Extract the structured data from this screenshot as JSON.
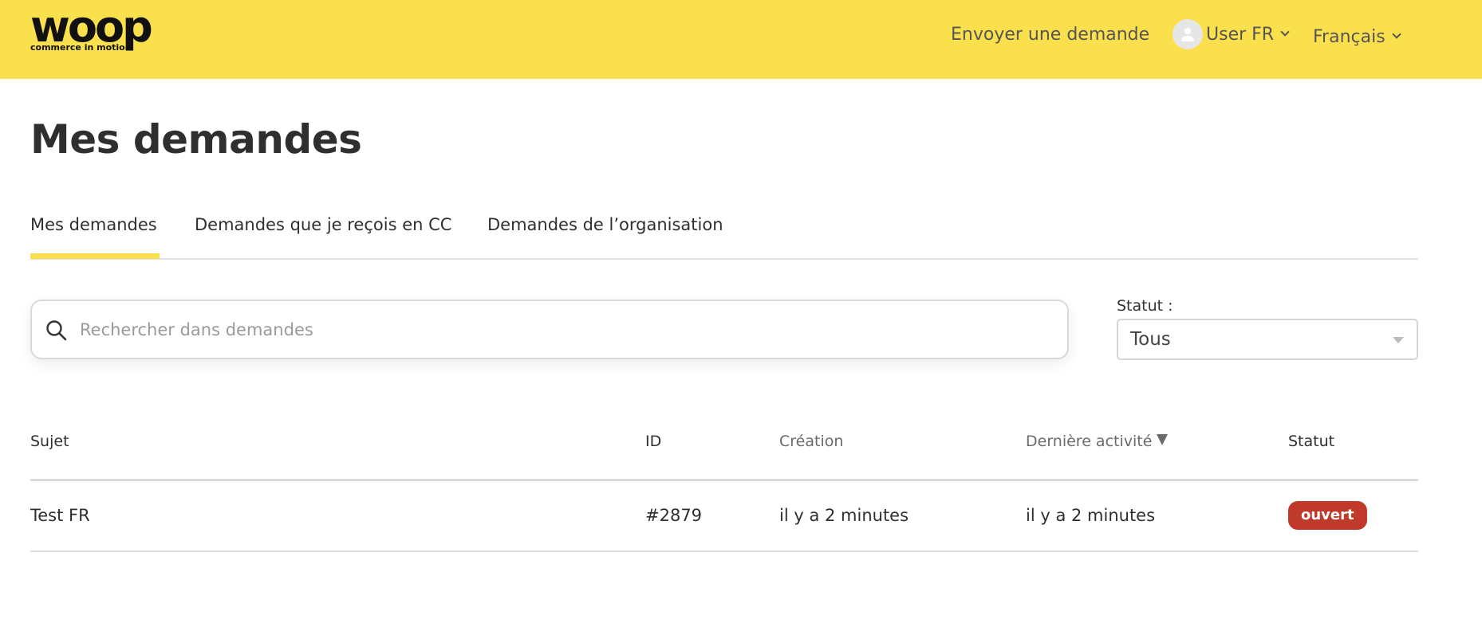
{
  "header": {
    "logo_word": "woop",
    "logo_tagline": "commerce in motion",
    "submit_request": "Envoyer une demande",
    "user_name": "User FR",
    "language": "Français"
  },
  "page": {
    "title": "Mes demandes"
  },
  "tabs": [
    {
      "label": "Mes demandes",
      "active": true
    },
    {
      "label": "Demandes que je reçois en CC",
      "active": false
    },
    {
      "label": "Demandes de l’organisation",
      "active": false
    }
  ],
  "search": {
    "placeholder": "Rechercher dans demandes",
    "value": ""
  },
  "status_filter": {
    "label": "Statut :",
    "selected": "Tous"
  },
  "table": {
    "columns": [
      "Sujet",
      "ID",
      "Création",
      "Dernière activité",
      "Statut"
    ],
    "rows": [
      {
        "subject": "Test FR",
        "id": "#2879",
        "created": "il y a 2 minutes",
        "last_activity": "il y a 2 minutes",
        "status": "ouvert"
      }
    ]
  },
  "colors": {
    "brand_yellow": "#fbe04d",
    "status_open": "#c0392b"
  }
}
